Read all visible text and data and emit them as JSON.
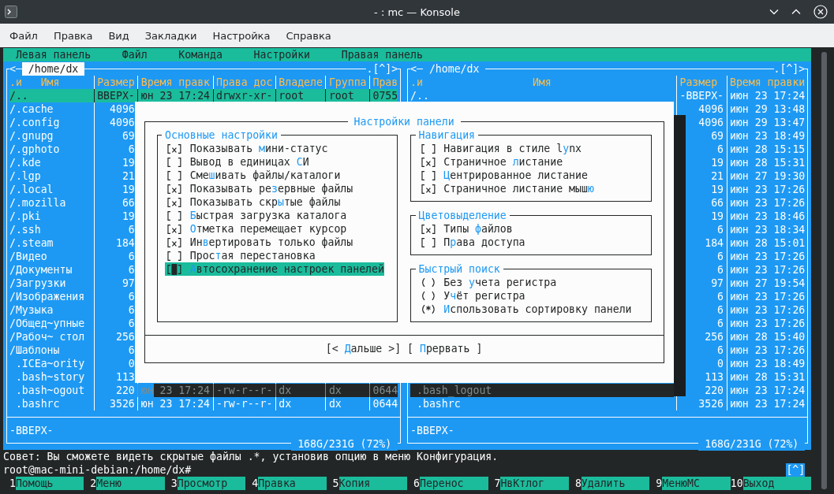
{
  "window": {
    "title": "- : mc — Konsole"
  },
  "menu": [
    "Файл",
    "Правка",
    "Вид",
    "Закладки",
    "Настройка",
    "Справка"
  ],
  "mc_menu": [
    "Левая панель",
    "Файл",
    "Команда",
    "Настройки",
    "Правая панель"
  ],
  "panels": [
    {
      "active": true,
      "history_mark": "<",
      "path": "/home/dx",
      "buttons_mark": ".[^]>",
      "columns": [
        {
          "sort": ".и",
          "label": "Имя"
        },
        {
          "label": "Размер"
        },
        {
          "label": "Время правк"
        },
        {
          "label": "Права дос"
        },
        {
          "label": "Владеле"
        },
        {
          "label": "Группа"
        },
        {
          "label": "Прав"
        }
      ],
      "rows": [
        {
          "kind": "dir",
          "selected": true,
          "cells": [
            "/..",
            "ВВЕРХ-",
            "юн 23 17:24",
            "drwxr-xr-",
            "root",
            "root",
            "0755"
          ]
        },
        {
          "kind": "dir",
          "selected": false,
          "cells": [
            "/.cache",
            "4096"
          ]
        },
        {
          "kind": "dir",
          "selected": false,
          "cells": [
            "/.config",
            "4096"
          ]
        },
        {
          "kind": "dir",
          "selected": false,
          "cells": [
            "/.gnupg",
            "69"
          ]
        },
        {
          "kind": "dir",
          "selected": false,
          "cells": [
            "/.gphoto",
            "6"
          ]
        },
        {
          "kind": "dir",
          "selected": false,
          "cells": [
            "/.kde",
            "19"
          ]
        },
        {
          "kind": "dir",
          "selected": false,
          "cells": [
            "/.lgp",
            "21"
          ]
        },
        {
          "kind": "dir",
          "selected": false,
          "cells": [
            "/.local",
            "19"
          ]
        },
        {
          "kind": "dir",
          "selected": false,
          "cells": [
            "/.mozilla",
            "66"
          ]
        },
        {
          "kind": "dir",
          "selected": false,
          "cells": [
            "/.pki",
            "19"
          ]
        },
        {
          "kind": "dir",
          "selected": false,
          "cells": [
            "/.ssh",
            "6"
          ]
        },
        {
          "kind": "dir",
          "selected": false,
          "cells": [
            "/.steam",
            "184"
          ]
        },
        {
          "kind": "dir",
          "selected": false,
          "cells": [
            "/Видео",
            "6"
          ]
        },
        {
          "kind": "dir",
          "selected": false,
          "cells": [
            "/Документы",
            "6"
          ]
        },
        {
          "kind": "dir",
          "selected": false,
          "cells": [
            "/Загрузки",
            "97"
          ]
        },
        {
          "kind": "dir",
          "selected": false,
          "cells": [
            "/Изображения",
            "6"
          ]
        },
        {
          "kind": "dir",
          "selected": false,
          "cells": [
            "/Музыка",
            "6"
          ]
        },
        {
          "kind": "dir",
          "selected": false,
          "cells": [
            "/Общед~упные",
            "6"
          ]
        },
        {
          "kind": "dir",
          "selected": false,
          "cells": [
            "/Рабоч~ стол",
            "256"
          ]
        },
        {
          "kind": "dir",
          "selected": false,
          "cells": [
            "/Шаблоны",
            "6"
          ]
        },
        {
          "kind": "file",
          "selected": false,
          "cells": [
            ".ICEa~ority",
            "0"
          ]
        },
        {
          "kind": "file",
          "selected": false,
          "cells": [
            ".bash~story",
            "113"
          ]
        },
        {
          "kind": "file",
          "selected": false,
          "shadowed": true,
          "cells": [
            ".bash~ogout",
            "220",
            "юн 23 17:24",
            "-rw-r--r-",
            "dx",
            "dx",
            "0644"
          ]
        },
        {
          "kind": "file",
          "selected": false,
          "cells": [
            ".bashrc",
            "3526",
            "юн 23 17:24",
            "-rw-r--r-",
            "dx",
            "dx",
            "0644"
          ]
        }
      ],
      "status": "-ВВЕРХ-",
      "disk": "168G/231G (72%)"
    },
    {
      "active": false,
      "history_mark": "<",
      "path": "/home/dx",
      "buttons_mark": ".[^]>",
      "columns": [
        {
          "sort": ".и",
          "label": "Имя"
        },
        {
          "label": "Размер"
        },
        {
          "label": "Время правки"
        }
      ],
      "rows": [
        {
          "kind": "dir",
          "selected": false,
          "cells": [
            "/..",
            "-ВВЕРХ-",
            "июн 23 17:24"
          ]
        },
        {
          "kind": "dir",
          "selected": false,
          "cells": [
            null,
            "4096",
            "июн 29 13:48"
          ]
        },
        {
          "kind": "dir",
          "selected": false,
          "cells": [
            null,
            "4096",
            "июн 29 13:47"
          ]
        },
        {
          "kind": "dir",
          "selected": false,
          "cells": [
            null,
            "69",
            "июн 23 18:49"
          ]
        },
        {
          "kind": "dir",
          "selected": false,
          "cells": [
            null,
            "6",
            "июн 28 15:15"
          ]
        },
        {
          "kind": "dir",
          "selected": false,
          "cells": [
            null,
            "19",
            "июн 28 15:31"
          ]
        },
        {
          "kind": "dir",
          "selected": false,
          "cells": [
            null,
            "21",
            "июн 27 19:30"
          ]
        },
        {
          "kind": "dir",
          "selected": false,
          "cells": [
            null,
            "19",
            "июн 23 17:26"
          ]
        },
        {
          "kind": "dir",
          "selected": false,
          "cells": [
            null,
            "66",
            "июн 23 17:26"
          ]
        },
        {
          "kind": "dir",
          "selected": false,
          "cells": [
            null,
            "19",
            "июн 23 18:46"
          ]
        },
        {
          "kind": "dir",
          "selected": false,
          "cells": [
            null,
            "6",
            "июн 23 18:34"
          ]
        },
        {
          "kind": "dir",
          "selected": false,
          "cells": [
            null,
            "184",
            "июн 28 15:01"
          ]
        },
        {
          "kind": "dir",
          "selected": false,
          "cells": [
            null,
            "6",
            "июн 23 17:26"
          ]
        },
        {
          "kind": "dir",
          "selected": false,
          "cells": [
            null,
            "6",
            "июн 23 17:26"
          ]
        },
        {
          "kind": "dir",
          "selected": false,
          "cells": [
            null,
            "97",
            "июн 27 19:54"
          ]
        },
        {
          "kind": "dir",
          "selected": false,
          "cells": [
            null,
            "6",
            "июн 23 17:26"
          ]
        },
        {
          "kind": "dir",
          "selected": false,
          "cells": [
            null,
            "6",
            "июн 23 17:26"
          ]
        },
        {
          "kind": "dir",
          "selected": false,
          "cells": [
            null,
            "6",
            "июн 23 17:26"
          ]
        },
        {
          "kind": "dir",
          "selected": false,
          "cells": [
            null,
            "256",
            "июн 28 15:40"
          ]
        },
        {
          "kind": "dir",
          "selected": false,
          "cells": [
            null,
            "6",
            "июн 23 17:26"
          ]
        },
        {
          "kind": "file",
          "selected": false,
          "cells": [
            null,
            "0",
            "июн 23 18:49"
          ]
        },
        {
          "kind": "file",
          "selected": false,
          "cells": [
            null,
            "113",
            "июн 28 15:31"
          ]
        },
        {
          "kind": "file",
          "selected": false,
          "shadowed": true,
          "cells": [
            ".bash_logout",
            "220",
            "июн 23 17:24"
          ]
        },
        {
          "kind": "file",
          "selected": false,
          "cells": [
            ".bashrc",
            "3526",
            "июн 23 17:24"
          ]
        }
      ],
      "status": "-ВВЕРХ-",
      "disk": "168G/231G (72%)"
    }
  ],
  "dialog": {
    "title": "Настройки панели",
    "groups": [
      {
        "title": "Основные настройки",
        "items": [
          {
            "kind": "checkbox",
            "checked": true,
            "selected": false,
            "pre": "Показывать ",
            "key": "м",
            "post": "ини-статус"
          },
          {
            "kind": "checkbox",
            "checked": false,
            "selected": false,
            "pre": "Вывод в единицах ",
            "key": "С",
            "post": "И"
          },
          {
            "kind": "checkbox",
            "checked": false,
            "selected": false,
            "pre": "Сме",
            "key": "ш",
            "post": "ивать файлы/каталоги"
          },
          {
            "kind": "checkbox",
            "checked": true,
            "selected": false,
            "pre": "Показывать ре",
            "key": "з",
            "post": "ервные файлы"
          },
          {
            "kind": "checkbox",
            "checked": true,
            "selected": false,
            "pre": "Показывать скр",
            "key": "ы",
            "post": "тые файлы"
          },
          {
            "kind": "checkbox",
            "checked": false,
            "selected": false,
            "key": "Б",
            "post": "ыстрая загрузка каталога"
          },
          {
            "kind": "checkbox",
            "checked": true,
            "selected": false,
            "key": "О",
            "post": "тметка перемещает курсор"
          },
          {
            "kind": "checkbox",
            "checked": true,
            "selected": false,
            "pre": "Ин",
            "key": "в",
            "post": "ертировать только файлы"
          },
          {
            "kind": "checkbox",
            "checked": false,
            "selected": false,
            "pre": "Прос",
            "key": "т",
            "post": "ая перестановка"
          },
          {
            "kind": "checkbox",
            "checked": false,
            "selected": true,
            "key": "А",
            "post": "втосохранение настроек панелей"
          }
        ]
      },
      {
        "title": "Навигация",
        "items": [
          {
            "kind": "checkbox",
            "checked": false,
            "selected": false,
            "pre": "Навигация в стиле l",
            "key": "y",
            "post": "nx"
          },
          {
            "kind": "checkbox",
            "checked": true,
            "selected": false,
            "pre": "Страничное ",
            "key": "л",
            "post": "истание"
          },
          {
            "kind": "checkbox",
            "checked": false,
            "selected": false,
            "key": "Ц",
            "post": "ентрированное листание"
          },
          {
            "kind": "checkbox",
            "checked": true,
            "selected": false,
            "pre": "Страничное листание мыш",
            "key": "ю"
          }
        ]
      },
      {
        "title": "Цветовыделение",
        "items": [
          {
            "kind": "checkbox",
            "checked": true,
            "selected": false,
            "pre": "Типы ",
            "key": "ф",
            "post": "айлов"
          },
          {
            "kind": "checkbox",
            "checked": false,
            "selected": false,
            "pre": "П",
            "key": "р",
            "post": "ава доступа"
          }
        ]
      },
      {
        "title": "Быстрый поиск",
        "items": [
          {
            "kind": "radio",
            "checked": false,
            "selected": false,
            "pre": "Без ",
            "key": "у",
            "post": "чета регистра"
          },
          {
            "kind": "radio",
            "checked": false,
            "selected": false,
            "pre": "У",
            "key": "ч",
            "post": "ёт регистра"
          },
          {
            "kind": "radio",
            "checked": true,
            "selected": false,
            "key": "И",
            "post": "спользовать сортировку панели"
          }
        ]
      }
    ],
    "buttons": [
      {
        "pre": "[< ",
        "key": "Д",
        "post": "альше >]"
      },
      {
        "pre": "[ ",
        "key": "П",
        "post": "рервать ]"
      }
    ]
  },
  "hint": "Совет: Вы сможете видеть скрытые файлы .*, установив опцию в меню Конфигурация.",
  "prompt": "root@mac-mini-debian:/home/dx#",
  "prompt_button": "[^]",
  "function_keys": [
    {
      "key": "1",
      "label": "Помощь"
    },
    {
      "key": "2",
      "label": "Меню"
    },
    {
      "key": "3",
      "label": "Просмотр"
    },
    {
      "key": "4",
      "label": "Правка"
    },
    {
      "key": "5",
      "label": "Копия"
    },
    {
      "key": "6",
      "label": "Перенос"
    },
    {
      "key": "7",
      "label": "НвКтлог"
    },
    {
      "key": "8",
      "label": "Удалить"
    },
    {
      "key": "9",
      "label": "МенюМС"
    },
    {
      "key": "10",
      "label": "Выход"
    }
  ]
}
